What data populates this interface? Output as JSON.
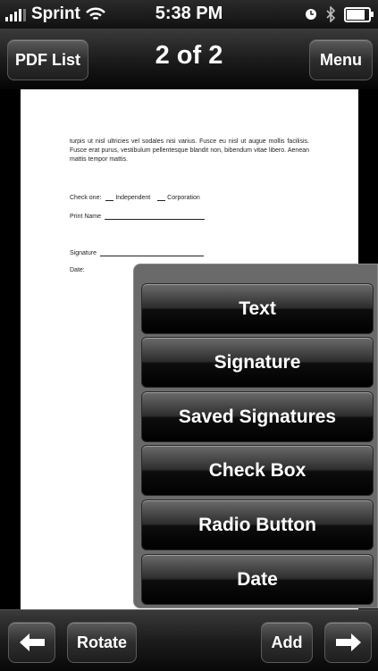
{
  "status_bar": {
    "carrier": "Sprint",
    "time": "5:38 PM",
    "battery_level": 0.75,
    "icons": [
      "signal-bars-icon",
      "wifi-icon",
      "alarm-clock-icon",
      "bluetooth-icon",
      "battery-icon"
    ]
  },
  "navbar": {
    "left_button": "PDF List",
    "title": "2 of 2",
    "right_button": "Menu"
  },
  "document": {
    "paragraph": "turpis ut nisl ultricies vel sodales nisi varius. Fusce eu nisl ut augue mollis facilisis. Fusce erat purus, vestibulum pellentesque blandit non, bibendum vitae libero. Aenean mattis tempor mattis.",
    "check_one_label": "Check one:",
    "option_independent": "Independent",
    "option_corporation": "Corporation",
    "print_name_label": "Print Name",
    "signature_label": "Signature",
    "date_label": "Date:"
  },
  "add_menu": {
    "items": [
      "Text",
      "Signature",
      "Saved Signatures",
      "Check Box",
      "Radio Button",
      "Date"
    ]
  },
  "toolbar": {
    "back_icon": "left-arrow-icon",
    "rotate_label": "Rotate",
    "add_label": "Add",
    "forward_icon": "right-arrow-icon"
  }
}
